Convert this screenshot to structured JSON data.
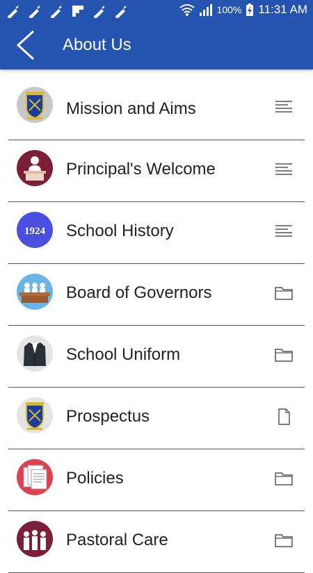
{
  "status_bar": {
    "notification_icons": [
      "bell-icon",
      "bell-icon",
      "bell-icon",
      "flipboard-icon",
      "bell-icon",
      "bell-icon"
    ],
    "battery_percent": "100%",
    "time": "11:31 AM"
  },
  "app_bar": {
    "title": "About Us",
    "back_icon": "chevron-left-icon"
  },
  "list": {
    "items": [
      {
        "label": "Mission and Aims",
        "icon": "school-crest-icon",
        "trailing_icon": "text-lines-icon"
      },
      {
        "label": "Principal's Welcome",
        "icon": "principal-at-desk-icon",
        "trailing_icon": "text-lines-icon"
      },
      {
        "label": "School History",
        "icon": "year-1924-badge-icon",
        "year_badge": "1924",
        "trailing_icon": "text-lines-icon"
      },
      {
        "label": "Board of Governors",
        "icon": "board-table-icon",
        "trailing_icon": "folder-icon"
      },
      {
        "label": "School Uniform",
        "icon": "blazer-icon",
        "trailing_icon": "folder-icon"
      },
      {
        "label": "Prospectus",
        "icon": "school-crest-icon",
        "trailing_icon": "document-icon"
      },
      {
        "label": "Policies",
        "icon": "documents-stack-icon",
        "trailing_icon": "folder-icon"
      },
      {
        "label": "Pastoral Care",
        "icon": "people-group-icon",
        "trailing_icon": "folder-icon"
      }
    ]
  },
  "colors": {
    "primary": "#2453b0",
    "maroon": "#7a1f35",
    "history_badge": "#4a4fe0",
    "board_sky": "#6ab4e6",
    "policies_red": "#e04050",
    "crest_gray": "#c8c8c8"
  }
}
